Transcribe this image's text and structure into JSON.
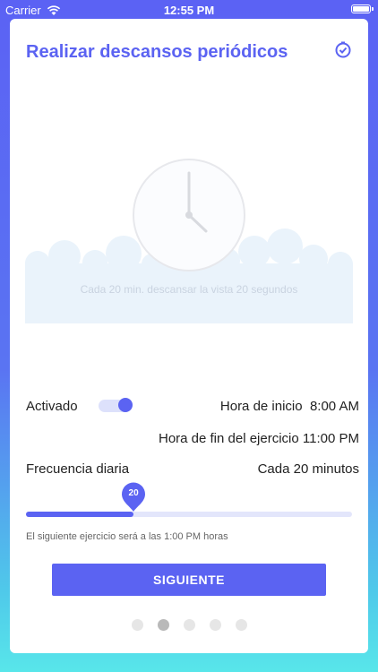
{
  "status": {
    "carrier": "Carrier",
    "time": "12:55 PM"
  },
  "card": {
    "title": "Realizar descansos periódicos",
    "illustration_caption": "Cada 20 min. descansar la vista 20 segundos"
  },
  "settings": {
    "enabled_label": "Activado",
    "enabled": true,
    "start_label": "Hora de inicio",
    "start_value": "8:00 AM",
    "end_label": "Hora de fin del ejercicio",
    "end_value": "11:00 PM",
    "frequency_label": "Frecuencia diaria",
    "frequency_value": "Cada 20 minutos",
    "slider_value": 20,
    "slider_fraction": 0.33,
    "next_exercise_note": "El siguiente ejercicio será a las 1:00 PM horas"
  },
  "actions": {
    "next_label": "SIGUIENTE"
  },
  "pagination": {
    "total": 5,
    "active_index": 1
  },
  "colors": {
    "accent": "#5b63f2",
    "track": "#e3e6fb"
  }
}
